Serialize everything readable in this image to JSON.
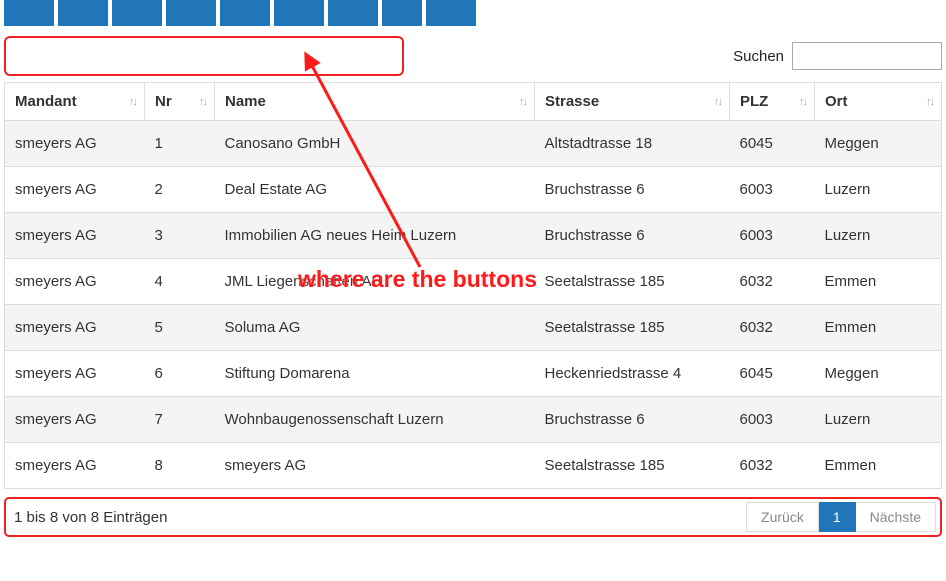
{
  "top_buttons_count": 9,
  "top_button_widths": [
    50,
    50,
    50,
    50,
    50,
    50,
    50,
    40,
    50
  ],
  "search": {
    "label": "Suchen",
    "value": ""
  },
  "columns": {
    "mandant": "Mandant",
    "nr": "Nr",
    "name": "Name",
    "strasse": "Strasse",
    "plz": "PLZ",
    "ort": "Ort"
  },
  "rows": [
    {
      "mandant": "smeyers AG",
      "nr": "1",
      "name": "Canosano GmbH",
      "strasse": "Altstadtrasse 18",
      "plz": "6045",
      "ort": "Meggen"
    },
    {
      "mandant": "smeyers AG",
      "nr": "2",
      "name": "Deal Estate AG",
      "strasse": "Bruchstrasse 6",
      "plz": "6003",
      "ort": "Luzern"
    },
    {
      "mandant": "smeyers AG",
      "nr": "3",
      "name": "Immobilien AG neues Heim Luzern",
      "strasse": "Bruchstrasse 6",
      "plz": "6003",
      "ort": "Luzern"
    },
    {
      "mandant": "smeyers AG",
      "nr": "4",
      "name": "JML Liegenschaften AG",
      "strasse": "Seetalstrasse 185",
      "plz": "6032",
      "ort": "Emmen"
    },
    {
      "mandant": "smeyers AG",
      "nr": "5",
      "name": "Soluma AG",
      "strasse": "Seetalstrasse 185",
      "plz": "6032",
      "ort": "Emmen"
    },
    {
      "mandant": "smeyers AG",
      "nr": "6",
      "name": "Stiftung Domarena",
      "strasse": "Heckenriedstrasse 4",
      "plz": "6045",
      "ort": "Meggen"
    },
    {
      "mandant": "smeyers AG",
      "nr": "7",
      "name": "Wohnbaugenossenschaft Luzern",
      "strasse": "Bruchstrasse 6",
      "plz": "6003",
      "ort": "Luzern"
    },
    {
      "mandant": "smeyers AG",
      "nr": "8",
      "name": "smeyers AG",
      "strasse": "Seetalstrasse 185",
      "plz": "6032",
      "ort": "Emmen"
    }
  ],
  "footer": {
    "info": "1 bis 8 von 8 Einträgen"
  },
  "pager": {
    "prev": "Zurück",
    "page": "1",
    "next": "Nächste"
  },
  "annotation": {
    "text": "where are the buttons"
  }
}
